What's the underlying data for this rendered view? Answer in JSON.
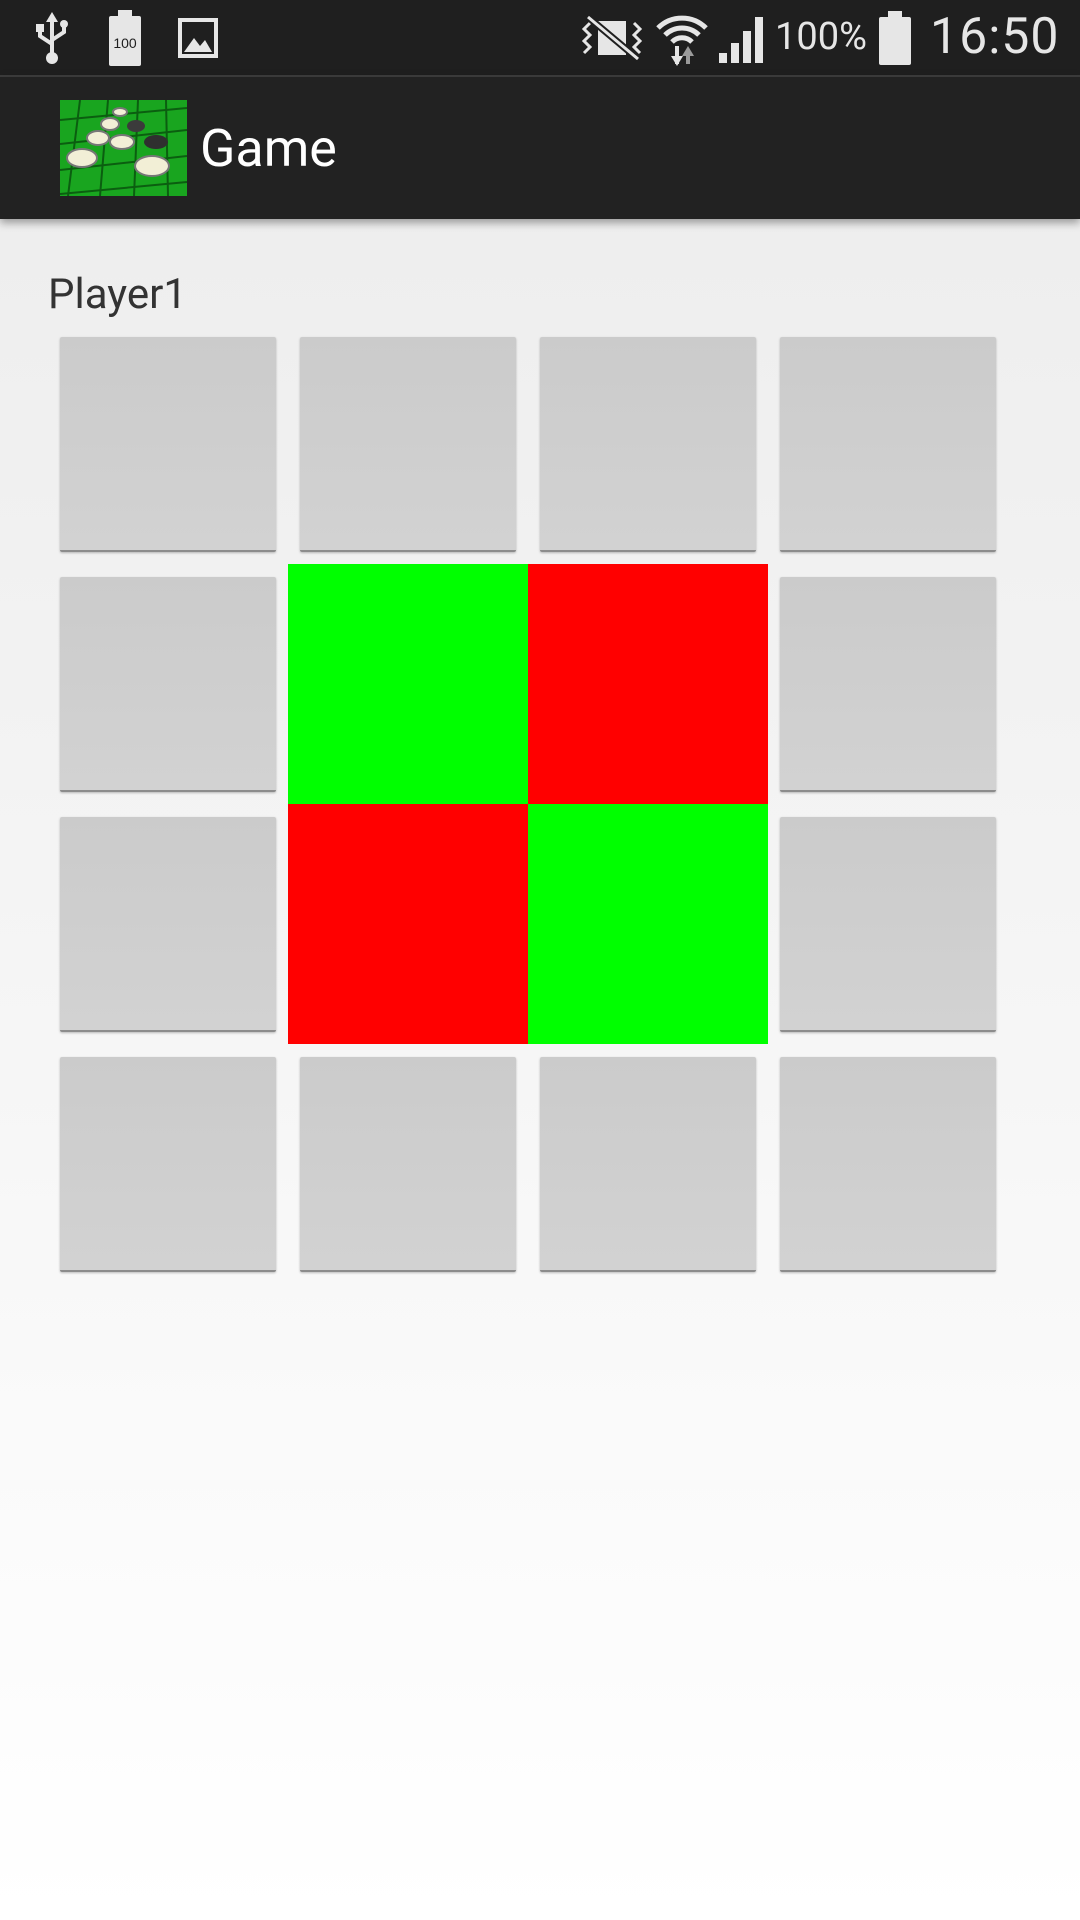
{
  "status_bar": {
    "left_icons": [
      "usb-icon",
      "battery-saver-icon",
      "gallery-icon"
    ],
    "right_icons": [
      "vibrate-silent-icon",
      "wifi-icon",
      "signal-icon",
      "battery-icon"
    ],
    "battery_percent": "100%",
    "battery_saver_label": "100",
    "time": "16:50"
  },
  "action_bar": {
    "title": "Game",
    "app_icon": "othello-board-icon"
  },
  "game": {
    "player_label": "Player1",
    "board": {
      "rows": 4,
      "cols": 4,
      "colors": {
        "empty": "#cfcfcf",
        "green": "#00ff00",
        "red": "#ff0000"
      },
      "cells": [
        [
          "empty",
          "empty",
          "empty",
          "empty"
        ],
        [
          "empty",
          "green",
          "red",
          "empty"
        ],
        [
          "empty",
          "red",
          "green",
          "empty"
        ],
        [
          "empty",
          "empty",
          "empty",
          "empty"
        ]
      ]
    }
  }
}
